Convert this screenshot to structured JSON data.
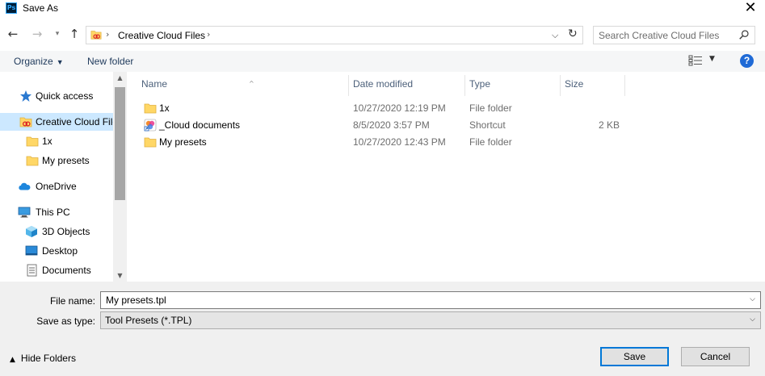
{
  "window": {
    "title": "Save As",
    "app_icon_label": "Ps",
    "close_glyph": "✕"
  },
  "nav": {
    "back_glyph": "←",
    "forward_glyph": "→",
    "recent_glyph": "▾",
    "up_glyph": "↑"
  },
  "address": {
    "sep": "›",
    "crumb": "Creative Cloud Files",
    "dropdown_glyph": "⌵",
    "refresh_glyph": "↻"
  },
  "search": {
    "placeholder": "Search Creative Cloud Files"
  },
  "commands": {
    "organize": "Organize",
    "organize_arrow": "▼",
    "new_folder": "New folder",
    "views_arrow": "▼",
    "help": "?"
  },
  "sidebar": {
    "items": [
      {
        "label": "Quick access",
        "icon": "star-icon"
      },
      {
        "label": "Creative Cloud Files",
        "icon": "creative-cloud-folder-icon",
        "selected": true
      },
      {
        "label": "1x",
        "icon": "folder-icon"
      },
      {
        "label": "My presets",
        "icon": "folder-icon"
      },
      {
        "label": "OneDrive",
        "icon": "cloud-icon"
      },
      {
        "label": "This PC",
        "icon": "monitor-icon"
      },
      {
        "label": "3D Objects",
        "icon": "cube-icon"
      },
      {
        "label": "Desktop",
        "icon": "desktop-icon"
      },
      {
        "label": "Documents",
        "icon": "documents-icon"
      }
    ],
    "scroll_up": "▲",
    "scroll_down": "▼"
  },
  "columns": {
    "name": "Name",
    "date_modified": "Date modified",
    "type": "Type",
    "size": "Size",
    "sort_glyph": "^"
  },
  "files": [
    {
      "name": "1x",
      "date": "10/27/2020 12:19 PM",
      "type": "File folder",
      "size": "",
      "icon": "folder-icon"
    },
    {
      "name": "_Cloud documents",
      "date": "8/5/2020 3:57 PM",
      "type": "Shortcut",
      "size": "2 KB",
      "icon": "cloud-documents-shortcut-icon"
    },
    {
      "name": "My presets",
      "date": "10/27/2020 12:43 PM",
      "type": "File folder",
      "size": "",
      "icon": "folder-icon"
    }
  ],
  "form": {
    "file_name_label": "File name:",
    "file_name_value": "My presets.tpl",
    "save_type_label": "Save as type:",
    "save_type_value": "Tool Presets (*.TPL)",
    "dropdown_glyph": "⌵"
  },
  "footer": {
    "hide_folders": "Hide Folders",
    "hide_folders_arrow": "▲",
    "save": "Save",
    "cancel": "Cancel"
  },
  "colors": {
    "selection": "#cce8ff",
    "accent": "#0078d7",
    "folder": "#ffd766",
    "help": "#1f6ad6"
  }
}
